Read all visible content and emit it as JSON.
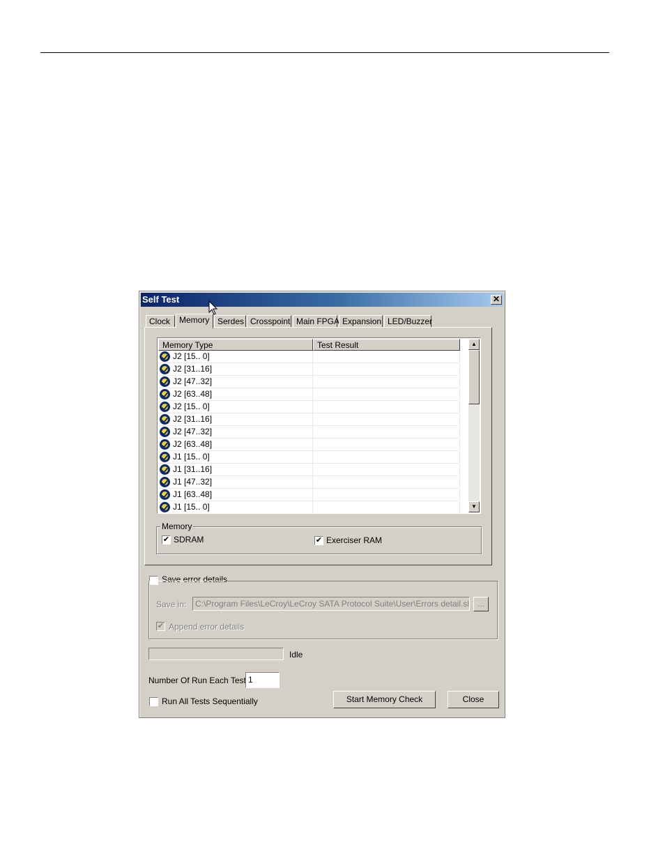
{
  "dialog": {
    "title": "Self Test",
    "close_glyph": "✕"
  },
  "tabs": [
    {
      "label": "Clock",
      "active": false
    },
    {
      "label": "Memory",
      "active": true
    },
    {
      "label": "Serdes",
      "active": false
    },
    {
      "label": "Crosspoint",
      "active": false
    },
    {
      "label": "Main FPGA",
      "active": false
    },
    {
      "label": "Expansion",
      "active": false
    },
    {
      "label": "LED/Buzzer",
      "active": false
    }
  ],
  "list": {
    "columns": [
      "Memory Type",
      "Test Result"
    ],
    "row_icon": "check-pass-icon",
    "rows": [
      {
        "type": "J2 [15.. 0]",
        "result": ""
      },
      {
        "type": "J2 [31..16]",
        "result": ""
      },
      {
        "type": "J2 [47..32]",
        "result": ""
      },
      {
        "type": "J2 [63..48]",
        "result": ""
      },
      {
        "type": "J2 [15.. 0]",
        "result": ""
      },
      {
        "type": "J2 [31..16]",
        "result": ""
      },
      {
        "type": "J2 [47..32]",
        "result": ""
      },
      {
        "type": "J2 [63..48]",
        "result": ""
      },
      {
        "type": "J1 [15.. 0]",
        "result": ""
      },
      {
        "type": "J1 [31..16]",
        "result": ""
      },
      {
        "type": "J1 [47..32]",
        "result": ""
      },
      {
        "type": "J1 [63..48]",
        "result": ""
      },
      {
        "type": "J1 [15.. 0]",
        "result": ""
      }
    ],
    "scroll_up_glyph": "▲",
    "scroll_down_glyph": "▼"
  },
  "memory_group": {
    "label": "Memory",
    "sdram": {
      "label": "SDRAM",
      "checked": true
    },
    "exerciser_ram": {
      "label": "Exerciser RAM",
      "checked": true
    }
  },
  "save_errors": {
    "label": "Save error details",
    "checked": false,
    "save_in_label": "Save in:",
    "save_in_value": "C:\\Program Files\\LeCroy\\LeCroy SATA Protocol Suite\\User\\Errors detail.slf",
    "browse_label": "...",
    "append_label": "Append error details",
    "append_checked": true
  },
  "status": {
    "progress": 0,
    "text": "Idle"
  },
  "run_count": {
    "label": "Number Of Run Each Test:",
    "value": "1"
  },
  "run_all": {
    "label": "Run All Tests Sequentially",
    "checked": false
  },
  "buttons": {
    "start": "Start Memory Check",
    "close": "Close"
  },
  "check_glyph": "✔"
}
